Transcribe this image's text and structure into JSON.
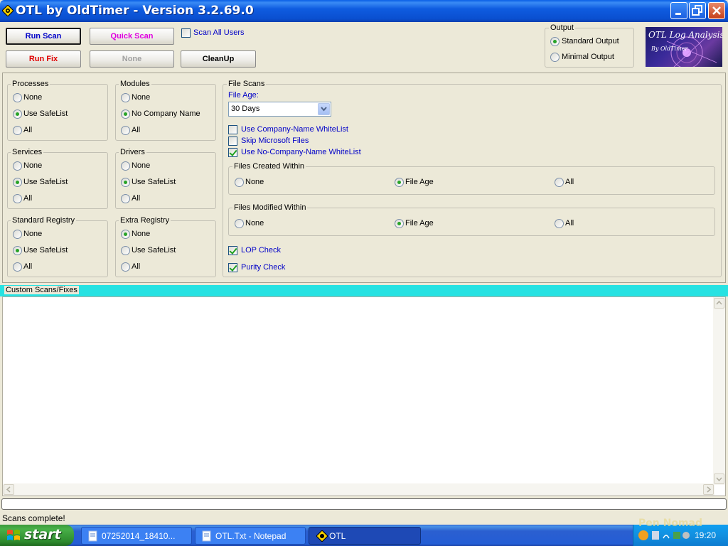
{
  "window": {
    "title": "OTL by OldTimer - Version 3.2.69.0"
  },
  "toolbar": {
    "run_scan": "Run Scan",
    "quick_scan": "Quick Scan",
    "scan_all_users": "Scan All Users",
    "run_fix": "Run Fix",
    "none": "None",
    "cleanup": "CleanUp",
    "colors": {
      "quick_scan": "#e000e0",
      "run_fix": "#e00000",
      "run_scan": "#0000c8"
    }
  },
  "output": {
    "title": "Output",
    "standard": "Standard Output",
    "minimal": "Minimal Output",
    "selected": "standard"
  },
  "logo": {
    "line1": "OTL Log Analysis",
    "line2": "By OldTimer"
  },
  "groups": {
    "processes": {
      "title": "Processes",
      "options": [
        "None",
        "Use SafeList",
        "All"
      ],
      "selected": 1
    },
    "modules": {
      "title": "Modules",
      "options": [
        "None",
        "No Company Name",
        "All"
      ],
      "selected": 1
    },
    "services": {
      "title": "Services",
      "options": [
        "None",
        "Use SafeList",
        "All"
      ],
      "selected": 1
    },
    "drivers": {
      "title": "Drivers",
      "options": [
        "None",
        "Use SafeList",
        "All"
      ],
      "selected": 1
    },
    "standard_registry": {
      "title": "Standard Registry",
      "options": [
        "None",
        "Use SafeList",
        "All"
      ],
      "selected": 1
    },
    "extra_registry": {
      "title": "Extra Registry",
      "options": [
        "None",
        "Use SafeList",
        "All"
      ],
      "selected": 0
    }
  },
  "file_scans": {
    "title": "File Scans",
    "file_age_label": "File Age:",
    "file_age_value": "30 Days",
    "use_company_whitelist": {
      "label": "Use Company-Name WhiteList",
      "checked": false
    },
    "skip_microsoft": {
      "label": "Skip Microsoft Files",
      "checked": false
    },
    "use_nocompany_whitelist": {
      "label": "Use No-Company-Name WhiteList",
      "checked": true
    },
    "created_within": {
      "title": "Files Created Within",
      "options": [
        "None",
        "File Age",
        "All"
      ],
      "selected": 1
    },
    "modified_within": {
      "title": "Files Modified Within",
      "options": [
        "None",
        "File Age",
        "All"
      ],
      "selected": 1
    },
    "lop_check": {
      "label": "LOP Check",
      "checked": true
    },
    "purity_check": {
      "label": "Purity Check",
      "checked": true
    }
  },
  "custom": {
    "title": "Custom Scans/Fixes",
    "text": ""
  },
  "status": {
    "text": "Scans complete!"
  },
  "taskbar": {
    "start": "start",
    "tasks": [
      "07252014_18410...",
      "OTL.Txt - Notepad",
      "OTL"
    ],
    "clock": "19:20",
    "watermark": "Pen  Nomad"
  }
}
